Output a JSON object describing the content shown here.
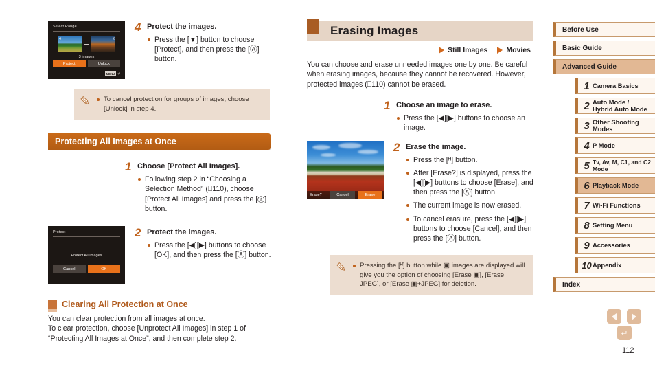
{
  "page_number": "112",
  "left_column": {
    "lcd_select_range": {
      "title": "Select Range",
      "left_index": "4",
      "right_index": "6",
      "caption": "3 images",
      "button_protect": "Protect",
      "button_unlock": "Unlock",
      "menu_hint": "MENU"
    },
    "step4": {
      "number": "4",
      "title": "Protect the images.",
      "bullets": [
        "Press the [▼] button to choose [Protect], and then press the [Ⓐ] button."
      ]
    },
    "note1": {
      "bullets": [
        "To cancel protection for groups of images, choose [Unlock] in step 4."
      ]
    },
    "section_heading": "Protecting All Images at Once",
    "step1": {
      "number": "1",
      "title": "Choose [Protect All Images].",
      "bullets": [
        "Following step 2 in “Choosing a Selection Method” (⎕110), choose [Protect All Images] and press the [Ⓐ] button."
      ]
    },
    "lcd_protect": {
      "title": "Protect",
      "message": "Protect All Images",
      "button_cancel": "Cancel",
      "button_ok": "OK"
    },
    "step2": {
      "number": "2",
      "title": "Protect the images.",
      "bullets": [
        "Press the [◀][▶] buttons to choose [OK], and then press the [Ⓐ] button."
      ]
    },
    "subsection_heading": "Clearing All Protection at Once",
    "subsection_text": [
      "You can clear protection from all images at once.",
      "To clear protection, choose [Unprotect All Images] in step 1 of “Protecting All Images at Once”, and then complete step 2."
    ]
  },
  "right_column": {
    "heading": "Erasing Images",
    "tags": [
      "Still Images",
      "Movies"
    ],
    "intro": "You can choose and erase unneeded images one by one. Be careful when erasing images, because they cannot be recovered. However, protected images (⎕110) cannot be erased.",
    "step1": {
      "number": "1",
      "title": "Choose an image to erase.",
      "bullets": [
        "Press the [◀][▶] buttons to choose an image."
      ]
    },
    "step2": {
      "number": "2",
      "title": "Erase the image.",
      "bullets": [
        "Press the [ᴴ] button.",
        "After [Erase?] is displayed, press the [◀][▶] buttons to choose [Erase], and then press the [Ⓐ] button.",
        "The current image is now erased.",
        "To cancel erasure, press the [◀][▶] buttons to choose [Cancel], and then press the [Ⓐ] button."
      ]
    },
    "lcd_erase": {
      "prompt": "Erase?",
      "button_cancel": "Cancel",
      "button_erase": "Erase"
    },
    "note": {
      "bullets": [
        "Pressing the [ᴴ] button while ▣ images are displayed will give you the option of choosing [Erase ▣], [Erase JPEG], or [Erase ▣+JPEG] for deletion."
      ]
    }
  },
  "sidebar": {
    "top_items": [
      {
        "label": "Before Use",
        "active": false
      },
      {
        "label": "Basic Guide",
        "active": false
      },
      {
        "label": "Advanced Guide",
        "active": true
      }
    ],
    "chapters": [
      {
        "number": "1",
        "label": "Camera Basics",
        "active": false
      },
      {
        "number": "2",
        "label": "Auto Mode /\nHybrid Auto Mode",
        "active": false
      },
      {
        "number": "3",
        "label": "Other Shooting Modes",
        "active": false
      },
      {
        "number": "4",
        "label": "P Mode",
        "active": false
      },
      {
        "number": "5",
        "label": "Tv, Av, M, C1, and C2 Mode",
        "active": false
      },
      {
        "number": "6",
        "label": "Playback Mode",
        "active": true
      },
      {
        "number": "7",
        "label": "Wi-Fi Functions",
        "active": false
      },
      {
        "number": "8",
        "label": "Setting Menu",
        "active": false
      },
      {
        "number": "9",
        "label": "Accessories",
        "active": false
      },
      {
        "number": "10",
        "label": "Appendix",
        "active": false
      }
    ],
    "index_label": "Index"
  },
  "footer_nav": {
    "prev_icon": "left-arrow-icon",
    "next_icon": "right-arrow-icon",
    "return_icon": "return-icon"
  },
  "colors": {
    "accent_orange": "#c0621c",
    "heading_bar": "#e6d5c6",
    "section_bar": "#c96a18",
    "note_bg": "#ecddd0",
    "sidebar_active": "#e2b894"
  }
}
